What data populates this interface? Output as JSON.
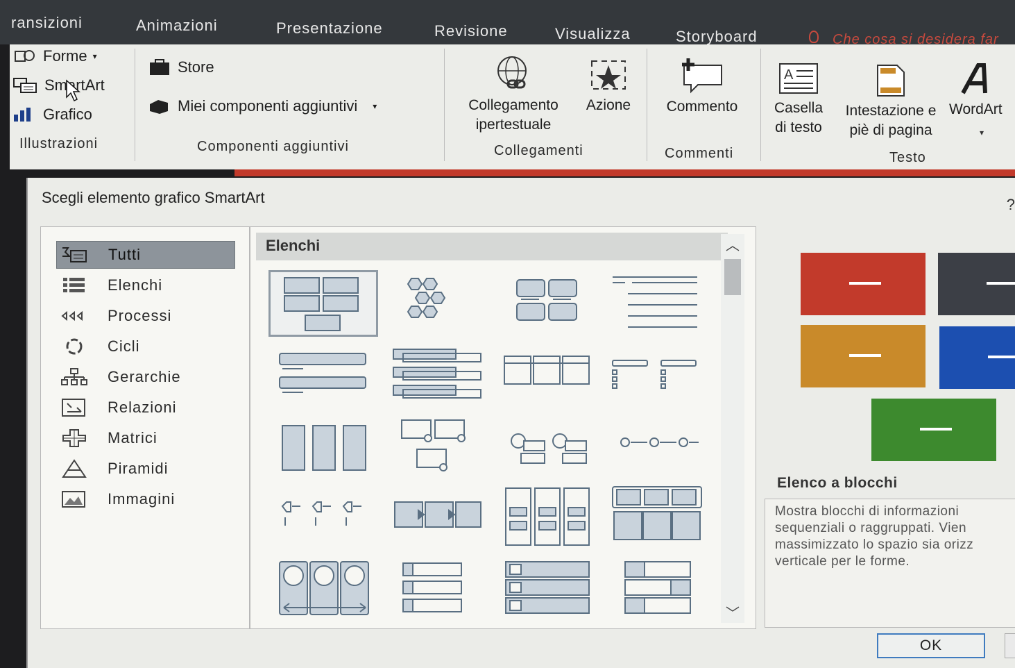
{
  "tabs": [
    "ransizioni",
    "Animazioni",
    "Presentazione",
    "Revisione",
    "Visualizza",
    "Storyboard"
  ],
  "tell_me": "Che cosa si desidera far",
  "ribbon": {
    "illustrazioni": {
      "forme": "Forme",
      "smartart": "SmartArt",
      "grafico": "Grafico",
      "label": "Illustrazioni"
    },
    "componenti": {
      "store": "Store",
      "miei": "Miei componenti aggiuntivi",
      "label": "Componenti aggiuntivi"
    },
    "collegamenti": {
      "collegamento_1": "Collegamento",
      "collegamento_2": "ipertestuale",
      "azione": "Azione",
      "label": "Collegamenti"
    },
    "commenti": {
      "commento": "Commento",
      "label": "Commenti"
    },
    "testo": {
      "casella_1": "Casella",
      "casella_2": "di testo",
      "intestazione_1": "Intestazione e",
      "intestazione_2": "piè di pagina",
      "wordart": "WordArt",
      "label": "Testo"
    }
  },
  "dialog": {
    "title": "Scegli elemento grafico SmartArt",
    "close": "?",
    "categories": [
      "Tutti",
      "Elenchi",
      "Processi",
      "Cicli",
      "Gerarchie",
      "Relazioni",
      "Matrici",
      "Piramidi",
      "Immagini"
    ],
    "selected_category": "Tutti",
    "gallery_header": "Elenchi",
    "preview_colors": [
      "#c23a2b",
      "#3c3f46",
      "#c98a2a",
      "#1c4fb0",
      "#3d8a2e"
    ],
    "preview_title": "Elenco a blocchi",
    "preview_desc": [
      "Mostra blocchi di informazioni",
      "sequenziali o raggruppati. Vien",
      "massimizzato lo spazio sia orizz",
      "verticale per le forme."
    ],
    "ok": "OK"
  }
}
